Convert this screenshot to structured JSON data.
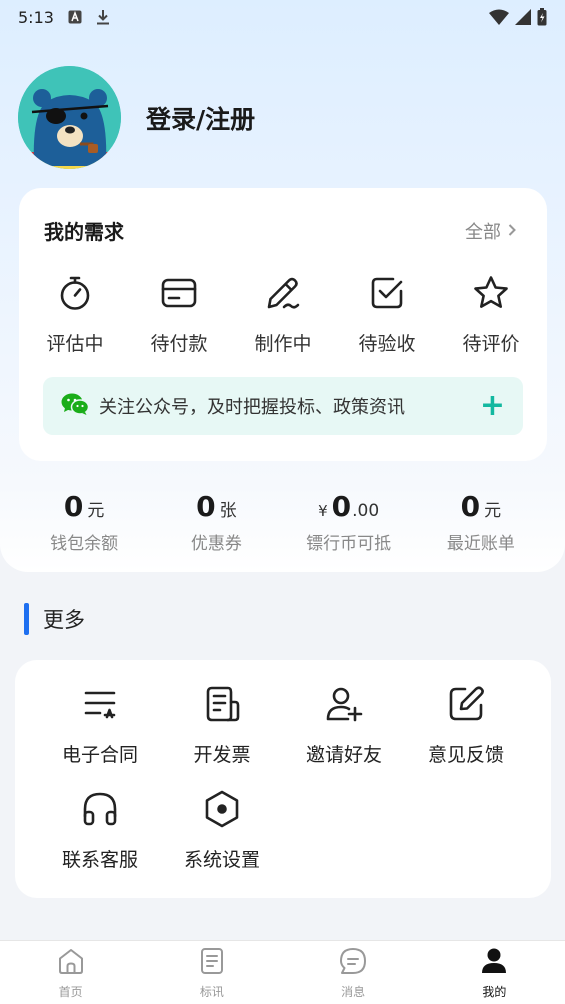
{
  "status_bar": {
    "time": "5:13"
  },
  "profile": {
    "login_label": "登录/注册"
  },
  "needs": {
    "title": "我的需求",
    "all_label": "全部",
    "items": [
      {
        "label": "评估中",
        "icon": "stopwatch-icon"
      },
      {
        "label": "待付款",
        "icon": "card-icon"
      },
      {
        "label": "制作中",
        "icon": "pen-icon"
      },
      {
        "label": "待验收",
        "icon": "check-square-icon"
      },
      {
        "label": "待评价",
        "icon": "star-icon"
      }
    ],
    "banner": {
      "text": "关注公众号，及时把握投标、政策资讯",
      "plus": "+"
    }
  },
  "stats": [
    {
      "value": "0",
      "unit": "元",
      "label": "钱包余额"
    },
    {
      "value": "0",
      "unit": "张",
      "label": "优惠券"
    },
    {
      "prefix": "¥",
      "value": "0",
      "decimal": ".00",
      "label": "镖行币可抵"
    },
    {
      "value": "0",
      "unit": "元",
      "label": "最近账单"
    }
  ],
  "more": {
    "title": "更多",
    "items": [
      {
        "label": "电子合同",
        "icon": "contract-icon"
      },
      {
        "label": "开发票",
        "icon": "invoice-icon"
      },
      {
        "label": "邀请好友",
        "icon": "add-user-icon"
      },
      {
        "label": "意见反馈",
        "icon": "edit-icon"
      },
      {
        "label": "联系客服",
        "icon": "headphones-icon"
      },
      {
        "label": "系统设置",
        "icon": "settings-hexagon-icon"
      }
    ]
  },
  "bottom_nav": [
    {
      "label": "首页",
      "icon": "home-icon"
    },
    {
      "label": "标讯",
      "icon": "document-icon"
    },
    {
      "label": "消息",
      "icon": "message-icon"
    },
    {
      "label": "我的",
      "icon": "user-icon",
      "active": true
    }
  ],
  "colors": {
    "accent": "#1e6ff0",
    "teal": "#13b8a0",
    "banner_bg": "#e7f8f5"
  }
}
